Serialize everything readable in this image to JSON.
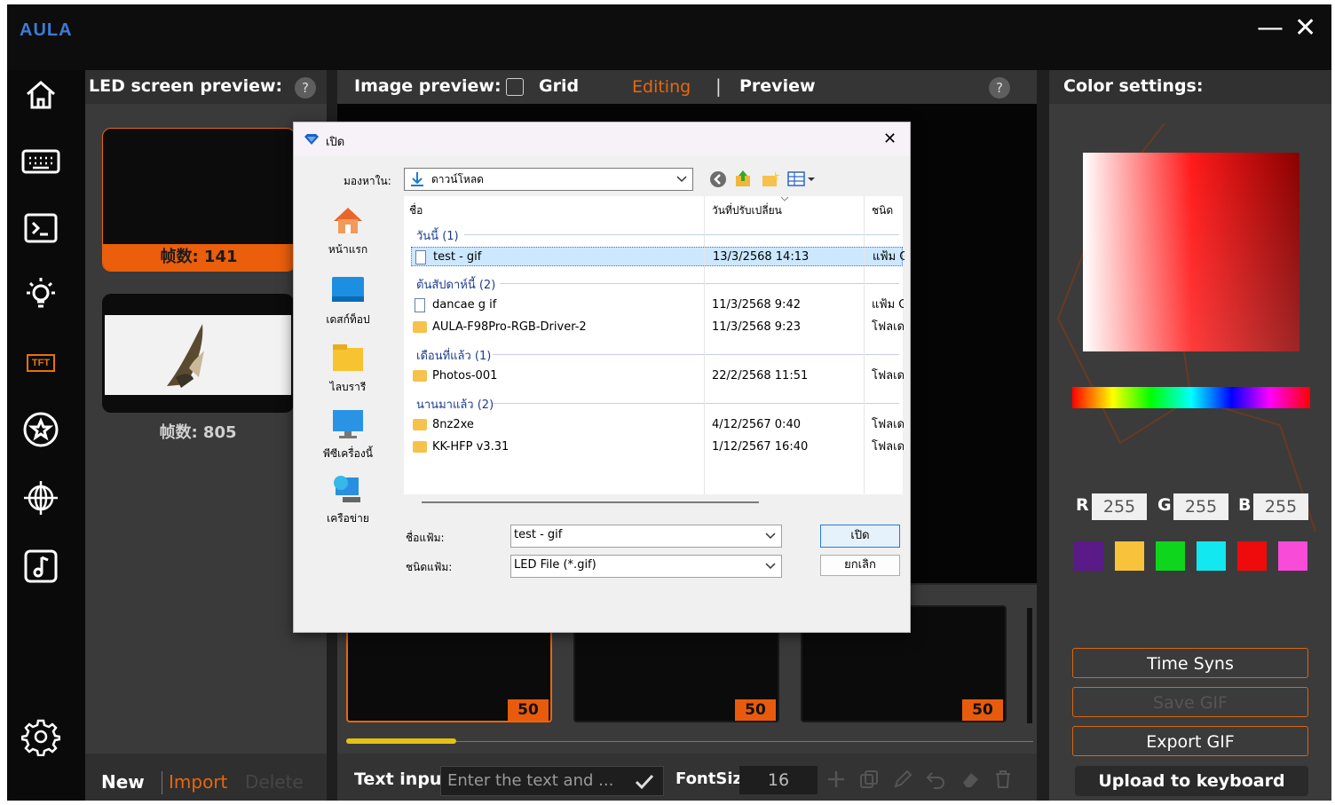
{
  "app": {
    "logo": "AULA",
    "minimize": "—",
    "close": "✕"
  },
  "nav": [
    {
      "name": "home-icon"
    },
    {
      "name": "keyboard-icon"
    },
    {
      "name": "terminal-icon"
    },
    {
      "name": "bulb-icon"
    },
    {
      "name": "tft-icon",
      "label": "TFT"
    },
    {
      "name": "star-icon"
    },
    {
      "name": "globe-icon"
    },
    {
      "name": "music-icon"
    },
    {
      "name": "gear-icon"
    }
  ],
  "led_preview": {
    "title": "LED screen preview:",
    "help": "?",
    "frames1": "帧数: 141",
    "frames2": "帧数: 805",
    "new": "New",
    "import": "Import",
    "delete": "Delete"
  },
  "image_preview": {
    "title": "Image preview:",
    "grid_label": "Grid",
    "editing": "Editing",
    "sep": "|",
    "preview": "Preview",
    "help": "?",
    "tile_badges": [
      "50",
      "50",
      "50"
    ],
    "progress": 0.16,
    "text_input_label": "Text inpu",
    "text_placeholder": "Enter the text and ...",
    "font_size_label": "FontSiz",
    "font_size_value": "16"
  },
  "color_settings": {
    "title": "Color settings:",
    "r_label": "R",
    "r": "255",
    "g_label": "G",
    "g": "255",
    "b_label": "B",
    "b": "255",
    "swatches": [
      "#5a1a87",
      "#f8c33a",
      "#0ed61c",
      "#11e8ef",
      "#ef0b0b",
      "#f74bd8"
    ],
    "time_syns": "Time Syns",
    "save_gif": "Save GIF",
    "export_gif": "Export GIF",
    "upload": "Upload to keyboard"
  },
  "dialog": {
    "title": "เปิด",
    "close": "✕",
    "look_in_label": "มองหาใน:",
    "look_in_value": "ดาวน์โหลด",
    "col_name": "ชื่อ",
    "col_date": "วันที่ปรับเปลี่ยน",
    "col_type": "ชนิด",
    "groups": [
      {
        "label": "วันนี้ (1)"
      },
      {
        "label": "ต้นสัปดาห์นี้ (2)"
      },
      {
        "label": "เดือนที่แล้ว (1)"
      },
      {
        "label": "นานมาแล้ว (2)"
      }
    ],
    "files": [
      {
        "name": "test - gif",
        "date": "13/3/2568 14:13",
        "type": "แฟ้ม GIF"
      },
      {
        "name": "dancae g if",
        "date": "11/3/2568 9:42",
        "type": "แฟ้ม GIF"
      },
      {
        "name": "AULA-F98Pro-RGB-Driver-2",
        "date": "11/3/2568 9:23",
        "type": "โฟลเดอร์"
      },
      {
        "name": "Photos-001",
        "date": "22/2/2568 11:51",
        "type": "โฟลเดอร์"
      },
      {
        "name": "8nz2xe",
        "date": "4/12/2567 0:40",
        "type": "โฟลเดอร์"
      },
      {
        "name": "KK-HFP v3.31",
        "date": "1/12/2567 16:40",
        "type": "โฟลเดอร์"
      }
    ],
    "places": [
      "หน้าแรก",
      "เดสก์ท็อป",
      "ไลบรารี",
      "พีซีเครื่องนี้",
      "เครือข่าย"
    ],
    "filename_label": "ชื่อแฟ้ม:",
    "filename_value": "test - gif",
    "filetype_label": "ชนิดแฟ้ม:",
    "filetype_value": "LED File (*.gif)",
    "open_button": "เปิด",
    "cancel_button": "ยกเลิก"
  }
}
